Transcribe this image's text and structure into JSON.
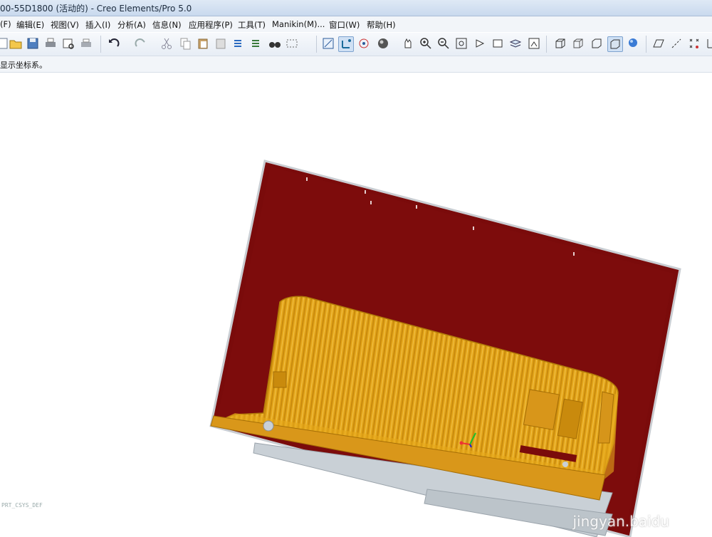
{
  "window": {
    "title": "00-55D1800 (活动的) - Creo Elements/Pro 5.0"
  },
  "menu": {
    "file": "(F)",
    "edit": "编辑(E)",
    "view": "视图(V)",
    "insert": "插入(I)",
    "analysis": "分析(A)",
    "info": "信息(N)",
    "applications": "应用程序(P)",
    "tools": "工具(T)",
    "manikin": "Manikin(M)...",
    "window": "窗口(W)",
    "help": "帮助(H)"
  },
  "toolbar": {
    "icons": [
      "new-icon",
      "open-icon",
      "save-icon",
      "print-icon",
      "print-preview-icon",
      "email-icon",
      "undo-icon",
      "redo-icon",
      "cut-icon",
      "copy-icon",
      "paste-icon",
      "paste-special-icon",
      "regenerate-icon",
      "find-icon",
      "select-box-icon",
      "datum-display-icon",
      "csys-display-icon",
      "spin-center-icon",
      "shading-icon",
      "pan-icon",
      "zoom-in-icon",
      "zoom-out-icon",
      "refit-icon",
      "reorient-icon",
      "saved-views-icon",
      "layers-icon",
      "wireframe-icon",
      "hidden-line-icon",
      "no-hidden-icon",
      "shaded-icon",
      "appearance-icon",
      "plane-icon",
      "axis-icon",
      "point-icon",
      "csys-icon"
    ]
  },
  "message": {
    "text": "显示坐标系。"
  },
  "viewport": {
    "csys_label": "PRT_CSYS_DEF",
    "watermark": "jingyan.baidu"
  },
  "colors": {
    "panel_red": "#7a0b0b",
    "housing_yellow": "#e6a81b",
    "stand_gray": "#c9d0d6"
  }
}
